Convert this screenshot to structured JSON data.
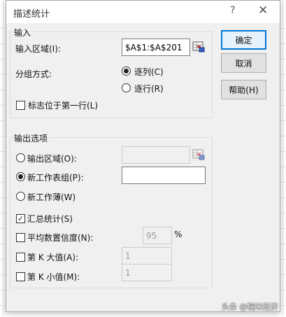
{
  "dialog": {
    "title": "描述统计",
    "help_glyph": "?",
    "close_glyph": "✕"
  },
  "input_group": {
    "label": "输入",
    "range_label": "输入区域(I):",
    "range_value": "$A$1:$A$201",
    "group_by_label": "分组方式:",
    "by_column_label": "逐列(C)",
    "by_row_label": "逐行(R)",
    "group_by_selected": "逐列(C)",
    "labels_first_row_label": "标志位于第一行(L)",
    "labels_first_row_checked": false
  },
  "output_group": {
    "label": "输出选项",
    "output_range_label": "输出区域(O):",
    "output_range_value": "",
    "new_sheet_label": "新工作表组(P):",
    "new_sheet_value": "",
    "new_workbook_label": "新工作薄(W)",
    "output_selected": "新工作表组(P):",
    "summary_stats_label": "汇总统计(S)",
    "summary_stats_checked": true,
    "confidence_label": "平均数置信度(N):",
    "confidence_value": "95",
    "confidence_unit": "%",
    "confidence_checked": false,
    "kth_largest_label": "第 K 大值(A):",
    "kth_largest_value": "1",
    "kth_largest_checked": false,
    "kth_smallest_label": "第 K 小值(M):",
    "kth_smallest_value": "1",
    "kth_smallest_checked": false
  },
  "buttons": {
    "ok": "确定",
    "cancel": "取消",
    "help": "帮助(H)"
  },
  "watermark": "头条 @糯米经济",
  "colors": {
    "dialog_bg": "#f0f0f0",
    "default_button_border": "#0078d7"
  }
}
